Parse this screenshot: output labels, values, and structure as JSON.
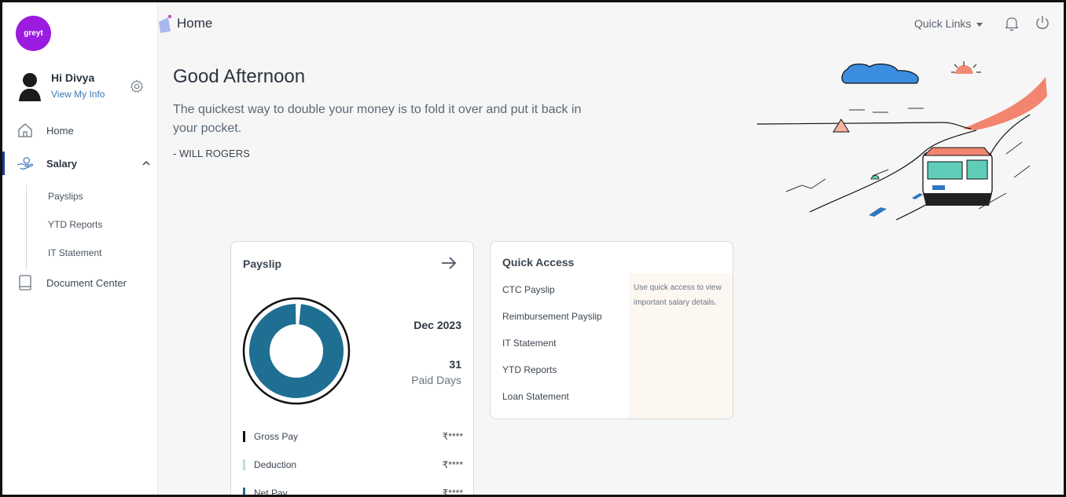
{
  "app": {
    "logo_text": "greyt"
  },
  "header": {
    "title": "Home",
    "quick_links": "Quick Links"
  },
  "user": {
    "greeting": "Hi Divya",
    "view_info": "View My Info"
  },
  "sidebar": {
    "items": [
      {
        "label": "Home",
        "icon": "home-icon"
      },
      {
        "label": "Salary",
        "icon": "salary-icon",
        "expanded": true
      },
      {
        "label": "Document Center",
        "icon": "book-icon"
      }
    ],
    "salary_sub": [
      {
        "label": "Payslips"
      },
      {
        "label": "YTD Reports"
      },
      {
        "label": "IT Statement"
      }
    ]
  },
  "hero": {
    "title": "Good Afternoon",
    "quote": "The quickest way to double your money is to fold it over and put it back in your pocket.",
    "author": "- WILL ROGERS"
  },
  "payslip": {
    "title": "Payslip",
    "month": "Dec 2023",
    "paid_days": "31",
    "paid_days_label": "Paid Days",
    "gross_share": 0.98,
    "legend": [
      {
        "label": "Gross Pay",
        "value": "₹****",
        "color": "#111111"
      },
      {
        "label": "Deduction",
        "value": "₹****",
        "color": "#b9e2c9"
      },
      {
        "label": "Net Pay",
        "value": "₹****",
        "color": "#1e6f92"
      }
    ]
  },
  "quick_access": {
    "title": "Quick Access",
    "links": [
      {
        "label": "CTC Payslip"
      },
      {
        "label": "Reimbursement Payslip"
      },
      {
        "label": "IT Statement"
      },
      {
        "label": "YTD Reports"
      },
      {
        "label": "Loan Statement"
      }
    ],
    "hint": "Use quick access to view important salary details."
  },
  "colors": {
    "brand": "#9b1be0",
    "donut": "#1e6f92",
    "active": "#1f3a93",
    "link": "#3a78b8"
  }
}
